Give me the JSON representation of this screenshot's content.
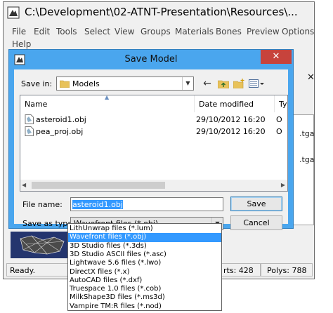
{
  "main_window": {
    "title": "C:\\Development\\02-ATNT-Presentation\\Resources\\...",
    "menu": [
      "File",
      "Edit",
      "Tools",
      "Select",
      "View",
      "Groups",
      "Materials",
      "Bones",
      "Preview",
      "Options",
      "Help"
    ],
    "background_texts": [
      ".tga",
      ".tga"
    ],
    "status": {
      "ready": "Ready.",
      "verts": "rts: 428",
      "polys": "Polys: 788"
    }
  },
  "dialog": {
    "title": "Save Model",
    "close_glyph": "✕",
    "save_in_label": "Save in:",
    "save_in_value": "Models",
    "columns": {
      "name": "Name",
      "date": "Date modified",
      "type": "Ty"
    },
    "files": [
      {
        "name": "asteroid1.obj",
        "date": "29/10/2012 16:20",
        "type": "O"
      },
      {
        "name": "pea_proj.obj",
        "date": "29/10/2012 16:20",
        "type": "O"
      }
    ],
    "file_name_label": "File name:",
    "file_name_value": "asteroid1.obj",
    "save_as_type_label": "Save as type:",
    "save_as_type_value": "Wavefront files (*.obj)",
    "save_label": "Save",
    "cancel_label": "Cancel"
  },
  "type_options": [
    "LithUnwrap files (*.lum)",
    "Wavefront files (*.obj)",
    "3D Studio files (*.3ds)",
    "3D Studio ASCII files (*.asc)",
    "Lightwave 5.6 files (*.lwo)",
    "DirectX files (*.x)",
    "AutoCAD files (*.dxf)",
    "Truespace 1.0 files (*.cob)",
    "MilkShape3D files (*.ms3d)",
    "Vampire TM:R files (*.nod)"
  ],
  "selected_type_index": 1,
  "colors": {
    "accent": "#3399ff",
    "dialog_frame": "#4aa6ee",
    "close": "#c7433c"
  }
}
